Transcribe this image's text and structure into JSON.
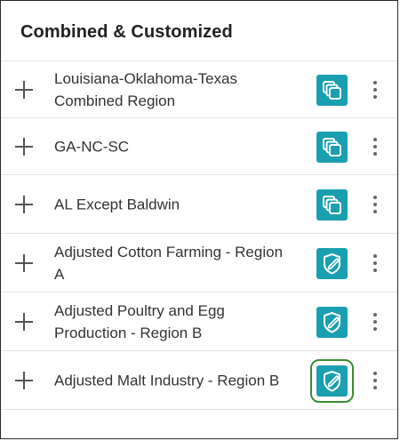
{
  "panel": {
    "title": "Combined & Customized",
    "accent_color": "#1a9fb0",
    "selected_outline_color": "#3d8b37"
  },
  "items": [
    {
      "label": "Louisiana-Oklahoma-Texas Combined Region",
      "icon": "combined-region-icon",
      "selected": false
    },
    {
      "label": "GA-NC-SC",
      "icon": "combined-region-icon",
      "selected": false
    },
    {
      "label": "AL Except Baldwin",
      "icon": "combined-region-icon",
      "selected": false
    },
    {
      "label": "Adjusted Cotton Farming - Region A",
      "icon": "customized-region-icon",
      "selected": false
    },
    {
      "label": "Adjusted Poultry and Egg Production - Region B",
      "icon": "customized-region-icon",
      "selected": false
    },
    {
      "label": "Adjusted Malt Industry - Region B",
      "icon": "customized-region-icon",
      "selected": true
    }
  ]
}
